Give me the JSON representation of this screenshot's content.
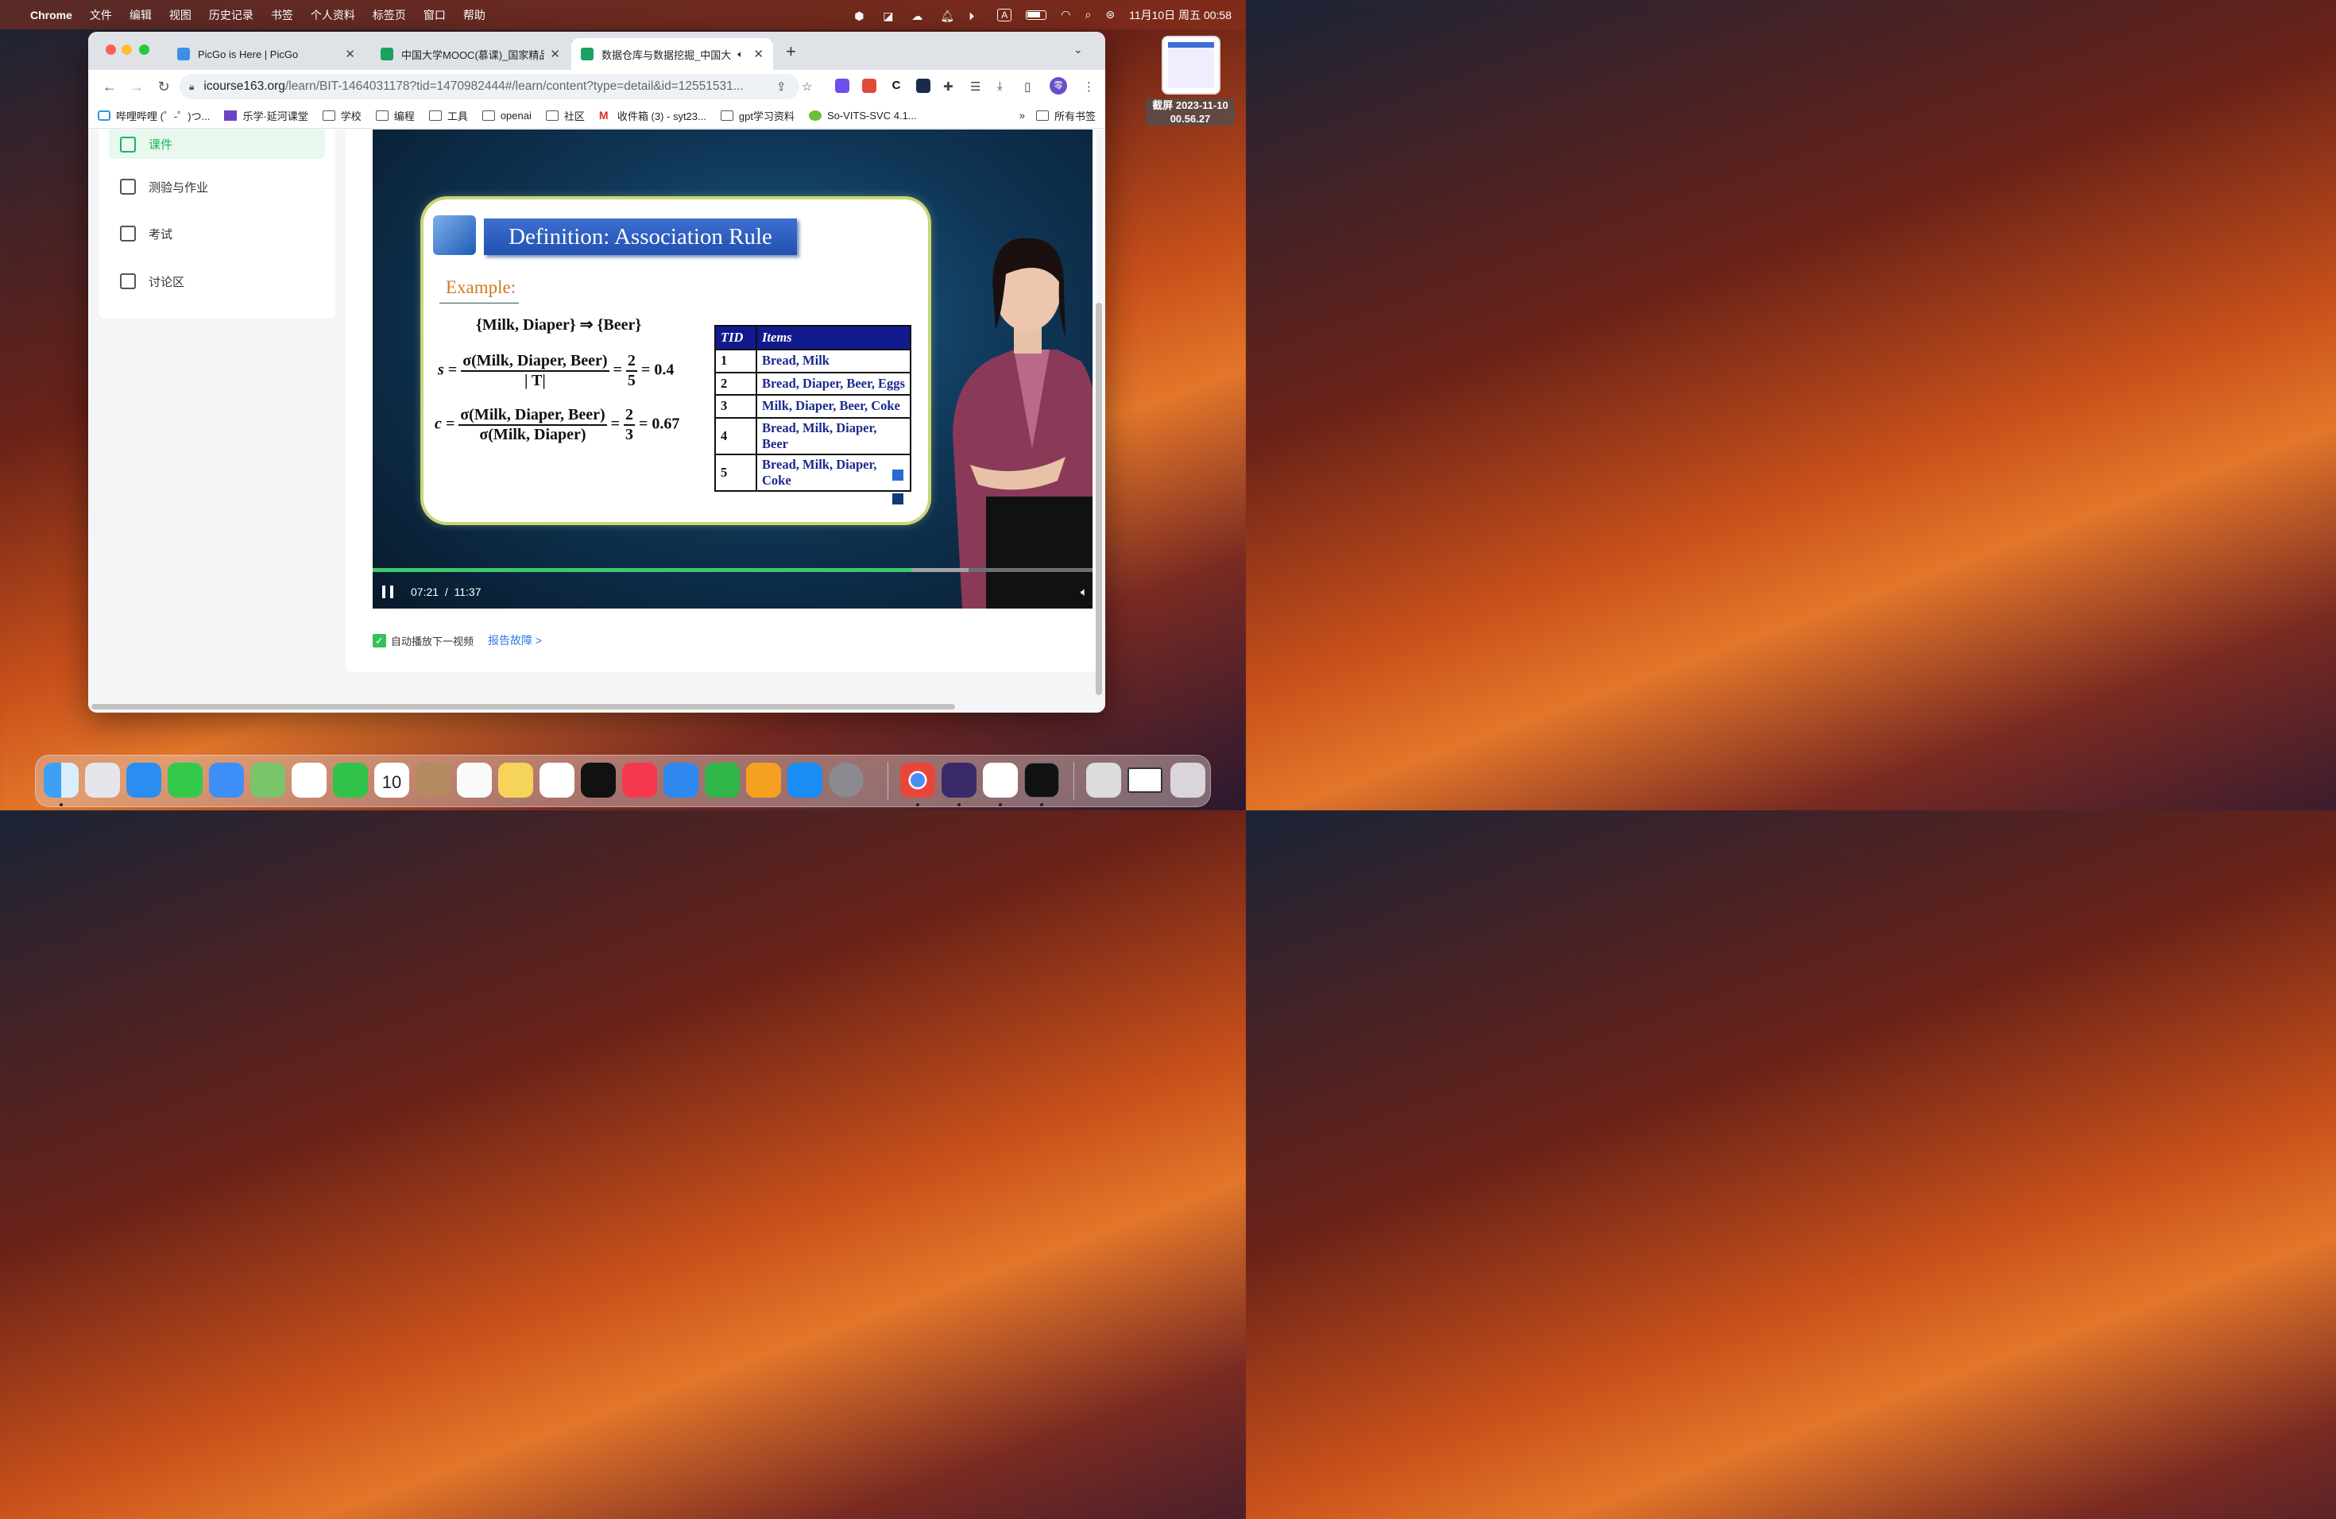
{
  "menubar": {
    "app_name": "Chrome",
    "items": [
      "文件",
      "编辑",
      "视图",
      "历史记录",
      "书签",
      "个人资料",
      "标签页",
      "窗口",
      "帮助"
    ],
    "input_method": "A",
    "datetime": "11月10日 周五 00:58"
  },
  "screenshot_thumb": {
    "label_line1": "截屏 2023-11-10",
    "label_line2": "00.56.27"
  },
  "tabs": [
    {
      "title": "PicGo is Here | PicGo",
      "icon_color": "#3c8ee6"
    },
    {
      "title": "中国大学MOOC(慕课)_国家精品",
      "icon_color": "#1aa260"
    },
    {
      "title": "数据仓库与数据挖掘_中国大",
      "icon_color": "#1aa260",
      "active": true
    }
  ],
  "address": {
    "domain": "icourse163.org",
    "path": "/learn/BIT-1464031178?tid=1470982444#/learn/content?type=detail&id=12551531..."
  },
  "profile_initial": "零",
  "bookmarks": [
    {
      "label": "哔哩哔哩 (゜-゜)つ...",
      "icon": "bilibili-icon"
    },
    {
      "label": "乐学·延河课堂",
      "icon": "lexue-icon"
    },
    {
      "label": "学校",
      "icon": "folder-icon"
    },
    {
      "label": "编程",
      "icon": "folder-icon"
    },
    {
      "label": "工具",
      "icon": "folder-icon"
    },
    {
      "label": "openai",
      "icon": "folder-icon"
    },
    {
      "label": "社区",
      "icon": "folder-icon"
    },
    {
      "label": "收件箱 (3) - syt23...",
      "icon": "gmail-icon"
    },
    {
      "label": "gpt学习资料",
      "icon": "folder-icon"
    },
    {
      "label": "So-VITS-SVC 4.1...",
      "icon": "leaf-icon"
    }
  ],
  "bookmarks_more": "»",
  "bookmarks_all": "所有书签",
  "sidebar": {
    "items": [
      {
        "label": "课件",
        "active": true
      },
      {
        "label": "测验与作业"
      },
      {
        "label": "考试"
      },
      {
        "label": "讨论区"
      }
    ]
  },
  "slide": {
    "title": "Definition: Association Rule",
    "example": "Example:",
    "rule": "{Milk, Diaper} ⇒ {Beer}",
    "s_lhs": "s =",
    "s_num": "σ(Milk, Diaper, Beer)",
    "s_den": "| T|",
    "s_eq": "=",
    "s_frac_num": "2",
    "s_frac_den": "5",
    "s_result": "= 0.4",
    "c_lhs": "c =",
    "c_num": "σ(Milk, Diaper, Beer)",
    "c_den": "σ(Milk, Diaper)",
    "c_eq": "=",
    "c_frac_num": "2",
    "c_frac_den": "3",
    "c_result": "= 0.67",
    "table": {
      "headers": [
        "TID",
        "Items"
      ],
      "rows": [
        [
          "1",
          "Bread, Milk"
        ],
        [
          "2",
          "Bread, Diaper, Beer, Eggs"
        ],
        [
          "3",
          "Milk, Diaper, Beer, Coke"
        ],
        [
          "4",
          "Bread, Milk, Diaper, Beer"
        ],
        [
          "5",
          "Bread, Milk, Diaper, Coke"
        ]
      ]
    }
  },
  "player": {
    "current": "07:21",
    "separator": "/",
    "duration": "11:37",
    "played_fraction": 0.748,
    "buffered_fraction": 0.828
  },
  "autoplay_label": "自动播放下一视频",
  "report_label": "报告故障 >",
  "colors": {
    "accent_green": "#20b35a",
    "link_blue": "#2d7be0",
    "progress": "#3dc86e"
  }
}
